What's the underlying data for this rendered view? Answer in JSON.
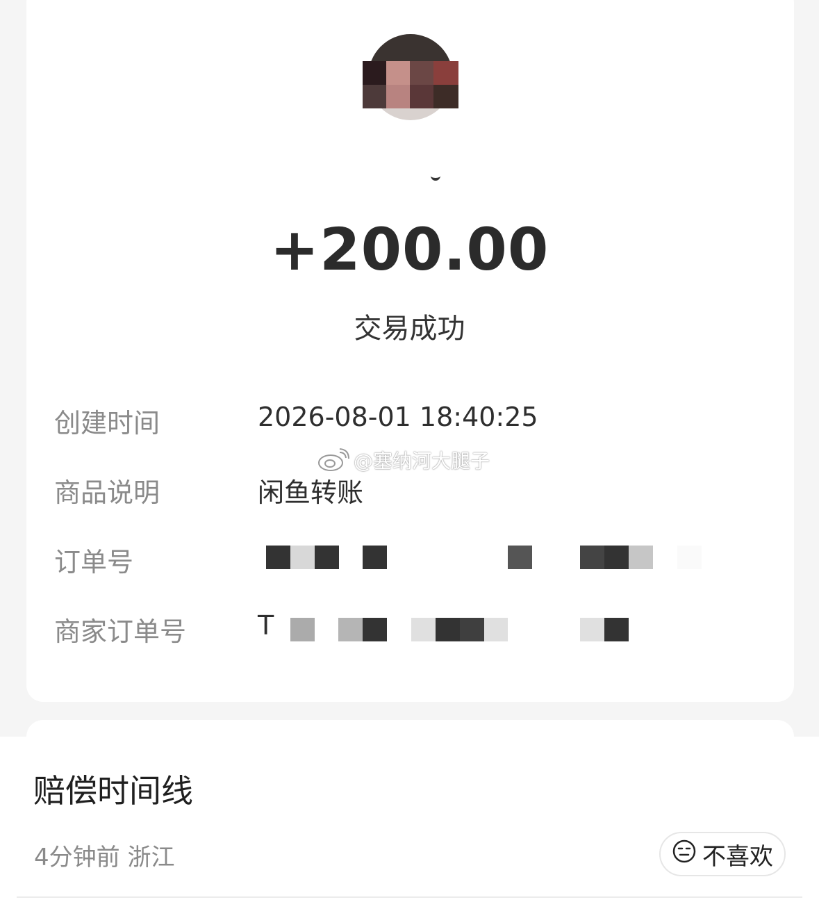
{
  "receipt": {
    "amount": "+200.00",
    "status": "交易成功",
    "rows": [
      {
        "label": "创建时间",
        "value": "2026-08-01 18:40:25"
      },
      {
        "label": "商品说明",
        "value": "闲鱼转账"
      },
      {
        "label": "订单号",
        "value": ""
      },
      {
        "label": "商家订单号",
        "value": "T"
      }
    ]
  },
  "watermark": {
    "text": "@塞纳河大腿子",
    "icon": "weibo-icon"
  },
  "feed": {
    "title": "赔偿时间线",
    "meta": "4分钟前 浙江",
    "dislike_label": "不喜欢",
    "dislike_icon": "neutral-face-icon"
  }
}
